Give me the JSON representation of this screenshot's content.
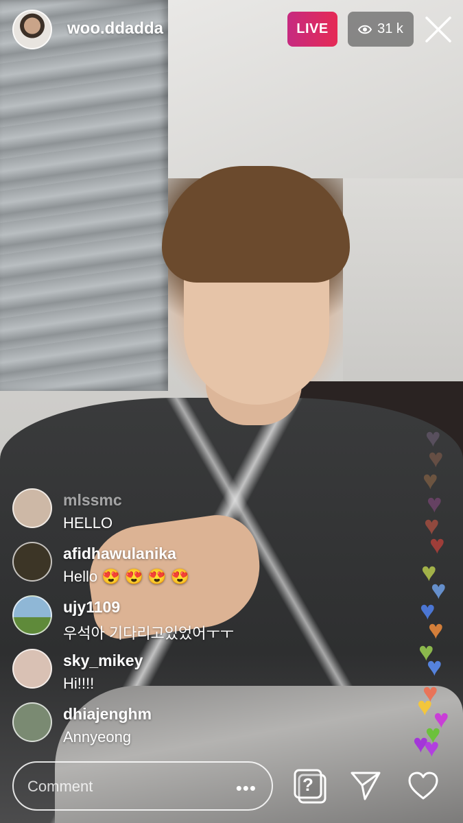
{
  "header": {
    "username": "woo.ddadda",
    "live_label": "LIVE",
    "viewer_count": "31 k",
    "viewer_icon": "eye-icon",
    "close_icon": "close-icon"
  },
  "comments": [
    {
      "user": "mlssmc",
      "text": "HELLO",
      "avatar_color": "#cdb8a6"
    },
    {
      "user": "afidhawulanika",
      "text": "Hello 😍 😍 😍 😍",
      "avatar_color": "#3c3526"
    },
    {
      "user": "ujy1109",
      "text": "우석아 기다리고있었어ㅜㅜ",
      "avatar_color": "#8fb7d6"
    },
    {
      "user": "sky_mikey",
      "text": "Hi!!!!",
      "avatar_color": "#d9c1b4"
    },
    {
      "user": "dhiajenghm",
      "text": "Annyeong",
      "avatar_color": "#7a8a72"
    }
  ],
  "bottom_bar": {
    "comment_placeholder": "Comment",
    "more_label": "•••",
    "question_icon": "question-box-icon",
    "send_icon": "send-icon",
    "like_icon": "heart-outline-icon"
  },
  "colors": {
    "live_gradient_start": "#c62a80",
    "live_gradient_end": "#e52a55"
  }
}
